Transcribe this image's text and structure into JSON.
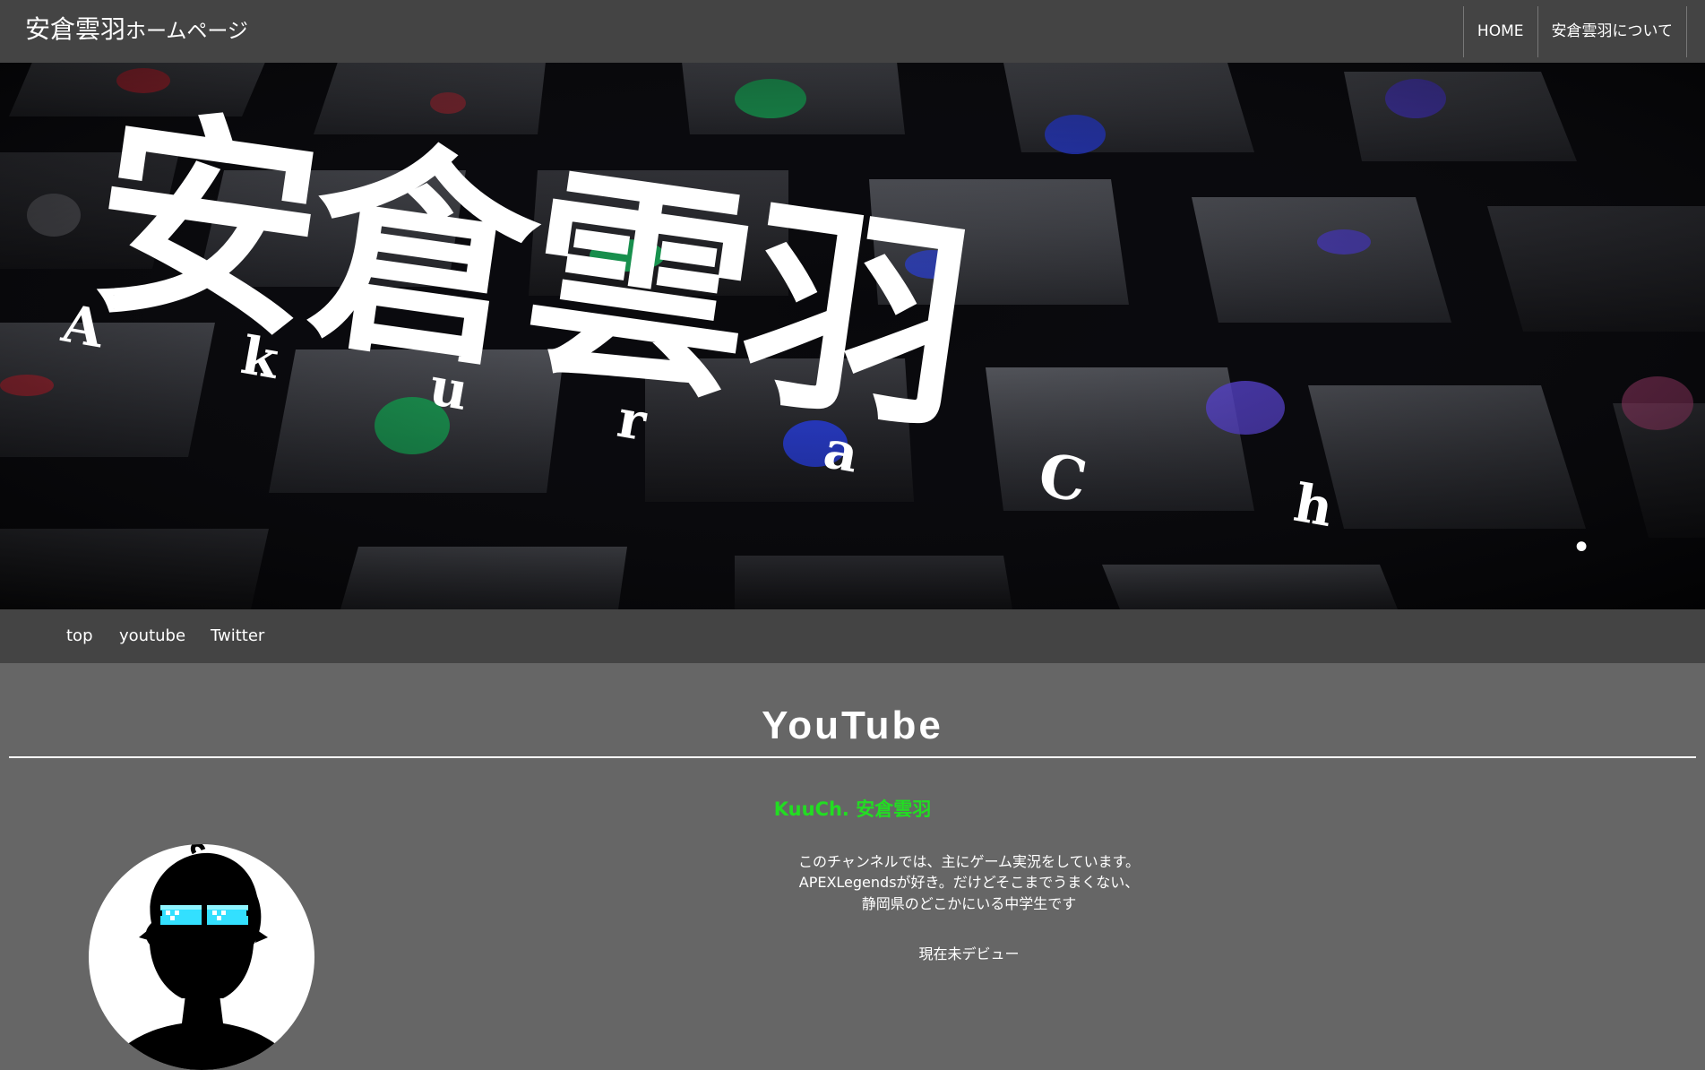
{
  "header": {
    "title_main": "安倉雲羽",
    "title_suffix": "ホームページ",
    "nav": [
      {
        "label": "HOME"
      },
      {
        "label": "安倉雲羽について"
      }
    ]
  },
  "hero": {
    "title": "安倉雲羽",
    "subtitle_letters": [
      "A",
      "k",
      "u",
      "r",
      "a",
      "C",
      "h",
      "."
    ]
  },
  "subnav": [
    {
      "label": "top"
    },
    {
      "label": "youtube"
    },
    {
      "label": "Twitter"
    }
  ],
  "main": {
    "heading": "YouTube",
    "channel_name": "KuuCh. 安倉雲羽",
    "description": [
      "このチャンネルでは、主にゲーム実況をしています。",
      "APEXLegendsが好き。だけどそこまでうまくない、",
      "静岡県のどこかにいる中学生です"
    ],
    "status": "現在未デビュー"
  },
  "colors": {
    "header_bg": "#444444",
    "page_bg": "#666666",
    "channel_accent": "#22dd22",
    "visor": "#33e0ff"
  }
}
